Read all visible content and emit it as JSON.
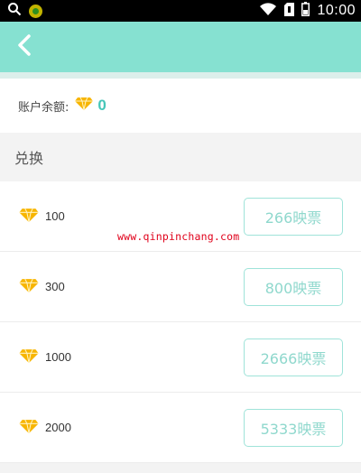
{
  "status_bar": {
    "time": "10:00",
    "icons": [
      "search-icon",
      "app-badge-icon",
      "wifi-icon",
      "sim-icon",
      "battery-icon"
    ]
  },
  "header": {
    "back_icon": "chevron-left-icon"
  },
  "balance": {
    "label": "账户余额:",
    "value": "0"
  },
  "section": {
    "title": "兑换"
  },
  "exchange_items": [
    {
      "amount": "100",
      "button_label": "266映票"
    },
    {
      "amount": "300",
      "button_label": "800映票"
    },
    {
      "amount": "1000",
      "button_label": "2666映票"
    },
    {
      "amount": "2000",
      "button_label": "5333映票"
    }
  ],
  "watermark": "www.qinpinchang.com",
  "colors": {
    "header": "#86e1d1",
    "accent": "#45c6b8",
    "button_border": "#9fe3d9",
    "diamond": "#f7b500",
    "watermark": "#e0001a"
  }
}
